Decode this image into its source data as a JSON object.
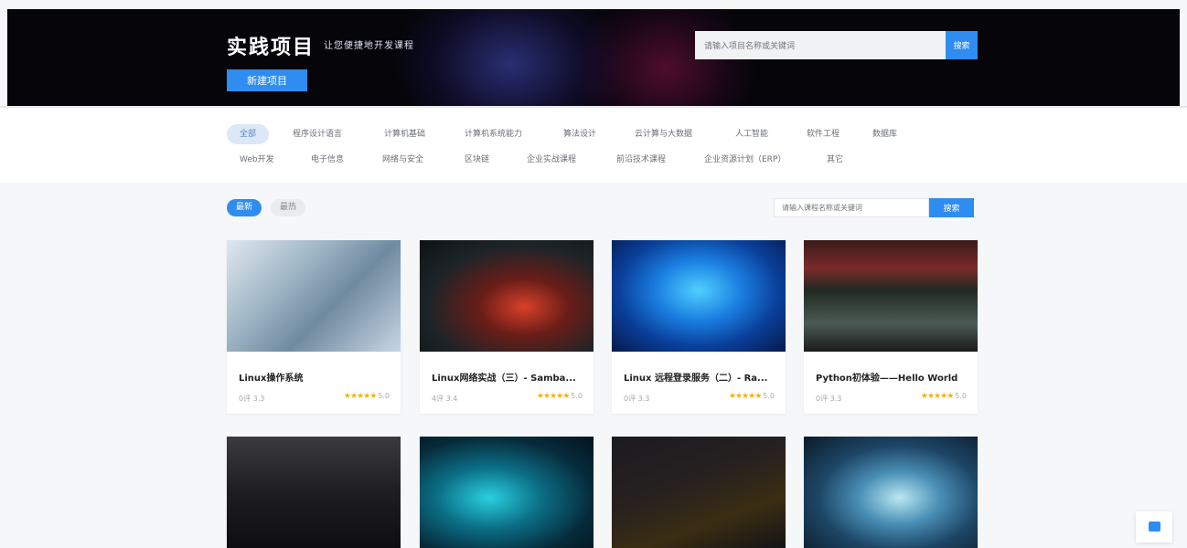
{
  "banner": {
    "title": "实践项目",
    "subtitle": "让您便捷地开发课程",
    "new_button": "新建项目",
    "search_placeholder": "请输入项目名称或关键词",
    "search_button": "搜索"
  },
  "categories": [
    "全部",
    "程序设计语言",
    "计算机基础",
    "计算机系统能力",
    "算法设计",
    "云计算与大数据",
    "人工智能",
    "软件工程",
    "数据库",
    "Web开发",
    "电子信息",
    "网络与安全",
    "区块链",
    "企业实战课程",
    "前沿技术课程",
    "企业资源计划（ERP）",
    "其它"
  ],
  "filters": {
    "latest": "最新",
    "hottest": "最热",
    "search_placeholder": "请输入课程名称或关键词",
    "search_button": "搜索"
  },
  "courses": [
    {
      "title": "Linux操作系统",
      "meta": "0评 3.3",
      "stars": "★★★★★",
      "rating": "5.0"
    },
    {
      "title": "Linux网络实战（三）- Samba...",
      "meta": "4评 3.4",
      "stars": "★★★★★",
      "rating": "5.0"
    },
    {
      "title": "Linux 远程登录服务（二）- Ra...",
      "meta": "0评 3.3",
      "stars": "★★★★★",
      "rating": "5.0"
    },
    {
      "title": "Python初体验——Hello World",
      "meta": "0评 3.3",
      "stars": "★★★★★",
      "rating": "5.0"
    },
    {
      "title": "",
      "meta": "",
      "stars": "",
      "rating": ""
    },
    {
      "title": "",
      "meta": "",
      "stars": "",
      "rating": ""
    },
    {
      "title": "",
      "meta": "",
      "stars": "",
      "rating": ""
    },
    {
      "title": "",
      "meta": "",
      "stars": "",
      "rating": ""
    }
  ]
}
